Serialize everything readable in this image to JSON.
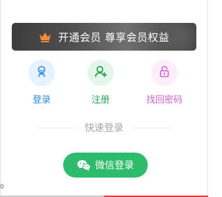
{
  "vip_banner": {
    "text": "开通会员 尊享会员权益",
    "icon": "crown-icon",
    "crown_color": "#f08a3c"
  },
  "actions": [
    {
      "label": "登录",
      "icon": "user-icon",
      "color": "#2d8ce4"
    },
    {
      "label": "注册",
      "icon": "add-user-icon",
      "color": "#27a550"
    },
    {
      "label": "找回密码",
      "icon": "lock-icon",
      "color": "#d45fd8"
    }
  ],
  "quick_login": {
    "divider_text": "快速登录",
    "wechat_button_label": "微信登录",
    "button_color": "#2dbc6c"
  }
}
